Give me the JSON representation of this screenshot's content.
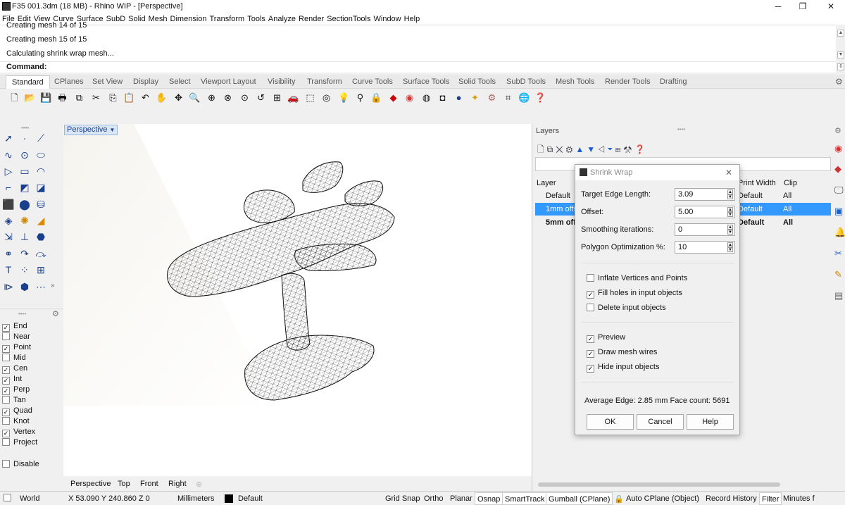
{
  "window": {
    "title": "F35 001.3dm (18 MB) - Rhino WIP - [Perspective]"
  },
  "menu": [
    "File",
    "Edit",
    "View",
    "Curve",
    "Surface",
    "SubD",
    "Solid",
    "Mesh",
    "Dimension",
    "Transform",
    "Tools",
    "Analyze",
    "Render",
    "SectionTools",
    "Window",
    "Help"
  ],
  "command": {
    "history": [
      "Creating mesh 14 of 15",
      "Creating mesh 15 of 15",
      "Calculating shrink wrap mesh..."
    ],
    "prompt": "Command:"
  },
  "tabs": [
    "Standard",
    "CPlanes",
    "Set View",
    "Display",
    "Select",
    "Viewport Layout",
    "Visibility",
    "Transform",
    "Curve Tools",
    "Surface Tools",
    "Solid Tools",
    "SubD Tools",
    "Mesh Tools",
    "Render Tools",
    "Drafting"
  ],
  "viewport": {
    "name": "Perspective",
    "tabs": [
      "Perspective",
      "Top",
      "Front",
      "Right"
    ]
  },
  "osnap": {
    "items": [
      {
        "label": "End",
        "checked": true
      },
      {
        "label": "Near",
        "checked": false
      },
      {
        "label": "Point",
        "checked": true
      },
      {
        "label": "Mid",
        "checked": false
      },
      {
        "label": "Cen",
        "checked": true
      },
      {
        "label": "Int",
        "checked": true
      },
      {
        "label": "Perp",
        "checked": true
      },
      {
        "label": "Tan",
        "checked": false
      },
      {
        "label": "Quad",
        "checked": true
      },
      {
        "label": "Knot",
        "checked": false
      },
      {
        "label": "Vertex",
        "checked": true
      },
      {
        "label": "Project",
        "checked": false
      }
    ],
    "disable": {
      "label": "Disable",
      "checked": false
    }
  },
  "layers": {
    "title": "Layers",
    "columns": {
      "layer": "Layer",
      "print_width": "Print Width",
      "clip": "Clip"
    },
    "rows": [
      {
        "name": "Default",
        "print": "Default",
        "clip": "All",
        "selected": false,
        "bold": false
      },
      {
        "name": "1mm offs",
        "print": "Default",
        "clip": "All",
        "selected": true,
        "bold": false
      },
      {
        "name": "5mm offs",
        "print": "Default",
        "clip": "All",
        "selected": false,
        "bold": true
      }
    ]
  },
  "dialog": {
    "title": "Shrink Wrap",
    "fields": [
      {
        "label": "Target Edge Length:",
        "value": "3.09"
      },
      {
        "label": "Offset:",
        "value": "5.00"
      },
      {
        "label": "Smoothing iterations:",
        "value": "0"
      },
      {
        "label": "Polygon Optimization %:",
        "value": "10"
      }
    ],
    "options": [
      {
        "label": "Inflate Vertices and Points",
        "checked": false
      },
      {
        "label": "Fill holes in input objects",
        "checked": true
      },
      {
        "label": "Delete input objects",
        "checked": false
      }
    ],
    "preview": [
      {
        "label": "Preview",
        "checked": true
      },
      {
        "label": "Draw mesh wires",
        "checked": true
      },
      {
        "label": "Hide input objects",
        "checked": true
      }
    ],
    "info": "Average Edge: 2.85 mm Face count: 5691",
    "buttons": {
      "ok": "OK",
      "cancel": "Cancel",
      "help": "Help"
    }
  },
  "status": {
    "cplane": "World",
    "coords": "X 53.090  Y 240.860  Z 0",
    "units": "Millimeters",
    "layer": "Default",
    "toggles": [
      "Grid Snap",
      "Ortho",
      "Planar",
      "Osnap",
      "SmartTrack",
      "Gumball (CPlane)",
      "Auto CPlane (Object)",
      "Record History",
      "Filter",
      "Minutes f"
    ]
  },
  "colors": {
    "accent": "#3399ff",
    "selected_row": "#3399ff",
    "vp_tag": "#d9e6f5"
  }
}
